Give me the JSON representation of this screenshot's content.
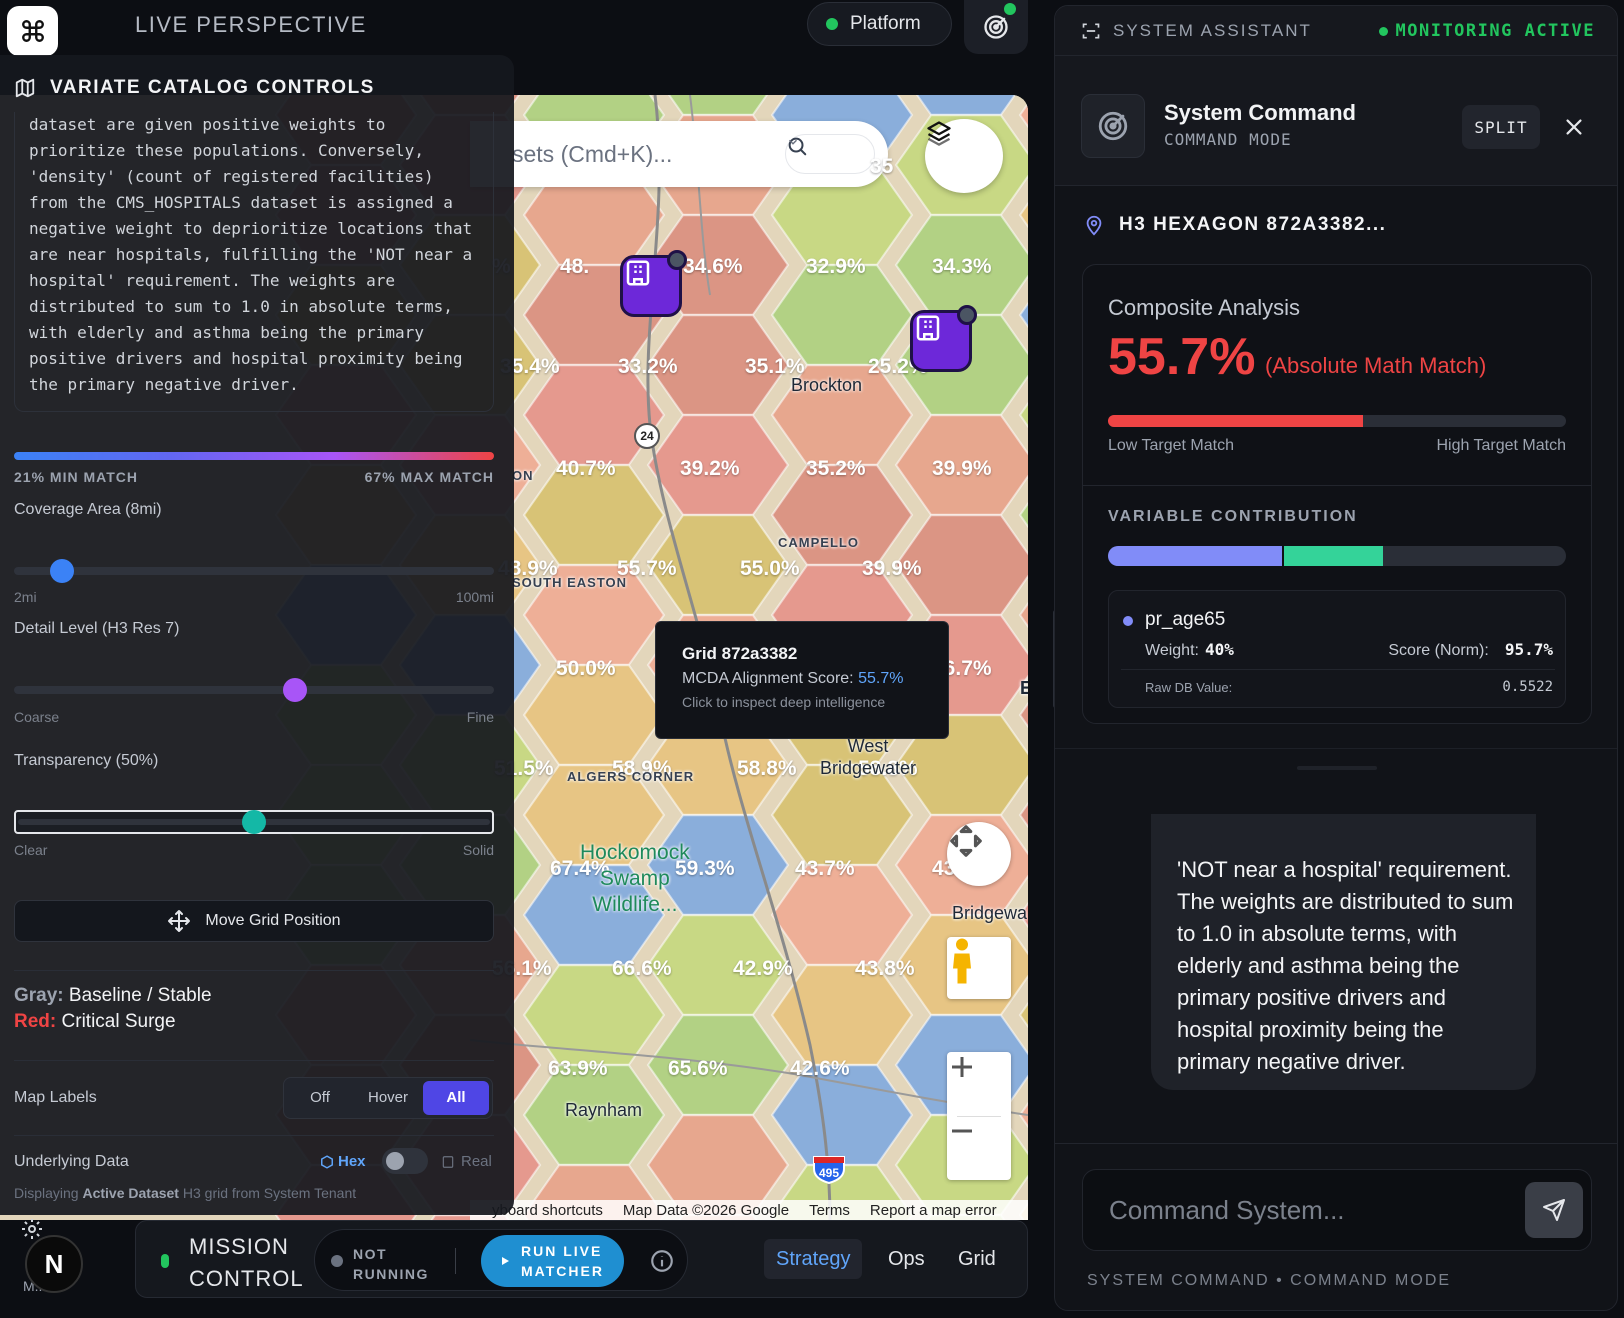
{
  "header": {
    "title": "LIVE PERSPECTIVE",
    "app_icon": "command-icon",
    "platform_label": "Platform",
    "status_color": "#22c55e"
  },
  "map": {
    "search_placeholder": "sets (Cmd+K)...",
    "hex_labels": [
      "48.",
      "34.6%",
      "32.9%",
      "34.3%",
      "35",
      "%",
      "35.4%",
      "33.2%",
      "35.1%",
      "25.2%",
      "40.7%",
      "39.2%",
      "35.2%",
      "39.9%",
      "48.9%",
      "55.7%",
      "55.0%",
      "39.9%",
      "50.0%",
      "46.7%",
      "51.5%",
      "58.9%",
      "58.8%",
      "58.8%",
      "67.4%",
      "59.3%",
      "43.7%",
      "43.7%",
      "56.1%",
      "66.6%",
      "42.9%",
      "43.8%",
      "63.9%",
      "65.6%",
      "42.6%"
    ],
    "places": {
      "brockton": "Brockton",
      "campello": "CAMPELLO",
      "south_easton": "SOUTH EASTON",
      "on": "ON",
      "west_bridgewater": "West\nBridgewater",
      "algers_corner": "ALGERS CORNER",
      "hockomock": "Hockomock\nSwamp\nWildlife...",
      "bridgewater": "Bridgewa",
      "raynham": "Raynham",
      "route_24": "24",
      "interstate_495": "495",
      "edge_e": "E"
    },
    "tooltip": {
      "title": "Grid 872a3382",
      "score_label": "MCDA Alignment Score:",
      "score_value": "55.7%",
      "hint": "Click to inspect deep intelligence"
    },
    "attribution": {
      "shortcuts": "yboard shortcuts",
      "data": "Map Data ©2026 Google",
      "terms": "Terms",
      "report": "Report a map error"
    }
  },
  "left_panel": {
    "title": "VARIATE CATALOG CONTROLS",
    "description": "dataset are given positive weights to prioritize these populations. Conversely, 'density' (count of registered facilities) from the CMS_HOSPITALS dataset is assigned a negative weight to deprioritize locations that are near hospitals, fulfilling the 'NOT near a hospital' requirement. The weights are distributed to sum to 1.0 in absolute terms, with elderly and asthma being the primary positive drivers and hospital proximity being the primary negative driver.",
    "min_match": "21% MIN MATCH",
    "max_match": "67% MAX MATCH",
    "coverage": {
      "label": "Coverage Area (8mi)",
      "min": "2mi",
      "max": "100mi",
      "value": 0.08
    },
    "detail": {
      "label": "Detail Level (H3 Res 7)",
      "min": "Coarse",
      "max": "Fine",
      "value": 0.59
    },
    "transparency": {
      "label": "Transparency (50%)",
      "min": "Clear",
      "max": "Solid",
      "value": 0.5
    },
    "move_button": "Move Grid Position",
    "legend": {
      "gray_key": "Gray:",
      "gray_val": "Baseline / Stable",
      "red_key": "Red:",
      "red_val": "Critical Surge"
    },
    "map_labels": {
      "label": "Map Labels",
      "options": [
        "Off",
        "Hover",
        "All"
      ],
      "selected": "All"
    },
    "underlying": {
      "label": "Underlying Data",
      "hex": "Hex",
      "real": "Real"
    },
    "displaying": {
      "prefix": "Displaying ",
      "bold": "Active Dataset",
      "suffix": " H3 grid from System Tenant"
    }
  },
  "left_rail": {
    "avatar_letter": "N",
    "user_short": "M..."
  },
  "bottom_bar": {
    "mission_control": "MISSION\nCONTROL",
    "status": "NOT\nRUNNING",
    "run_button": "RUN LIVE\nMATCHER",
    "tabs": [
      "Strategy",
      "Ops",
      "Grid"
    ],
    "active_tab": "Strategy"
  },
  "right_panel": {
    "title": "SYSTEM ASSISTANT",
    "monitoring": "MONITORING ACTIVE",
    "command_title": "System Command",
    "command_mode": "COMMAND MODE",
    "split": "SPLIT",
    "hexagon": "H3 HEXAGON 872A3382...",
    "composite": {
      "title": "Composite Analysis",
      "value": "55.7%",
      "subtitle": "(Absolute Math Match)",
      "fill": 0.557,
      "low": "Low Target Match",
      "high": "High Target Match"
    },
    "contribution": {
      "title": "VARIABLE CONTRIBUTION",
      "segments": [
        {
          "share": 0.38,
          "color": "#818cf8"
        },
        {
          "share": 0.22,
          "color": "#34d399"
        }
      ]
    },
    "variable": {
      "name": "pr_age65",
      "weight_label": "Weight:",
      "weight": "40%",
      "score_label": "Score (Norm):",
      "score": "95.7%",
      "raw_label": "Raw DB Value:",
      "raw": "0.5522"
    },
    "chat_text": "'NOT near a hospital' requirement. The weights are distributed to sum to 1.0 in absolute terms, with elderly and asthma being the primary positive drivers and hospital proximity being the primary negative driver.",
    "input_placeholder": "Command System...",
    "footer": "SYSTEM COMMAND • COMMAND MODE"
  }
}
